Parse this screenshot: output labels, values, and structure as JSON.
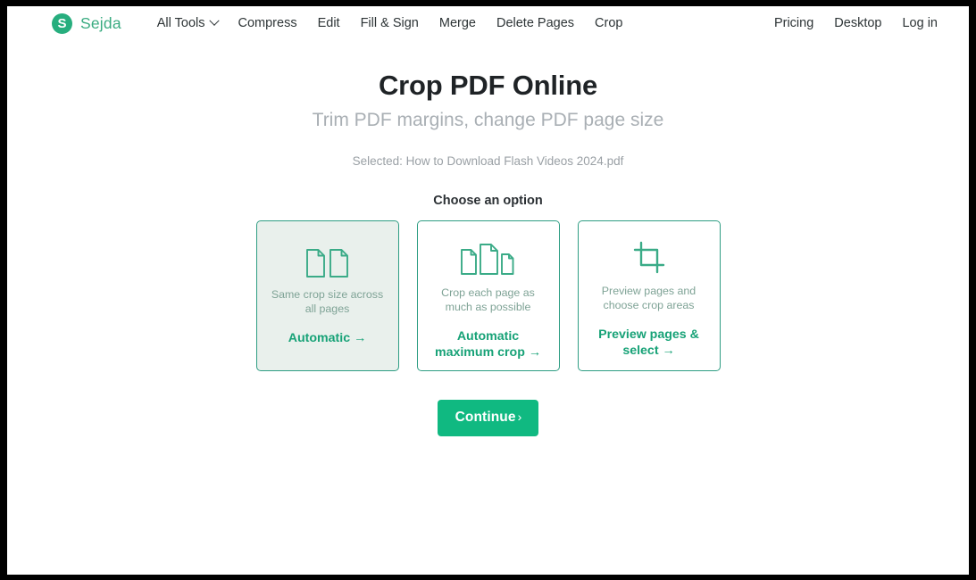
{
  "brand": {
    "mark": "S",
    "name": "Sejda"
  },
  "nav": {
    "left": [
      {
        "label": "All Tools",
        "has_chevron": true
      },
      {
        "label": "Compress",
        "has_chevron": false
      },
      {
        "label": "Edit",
        "has_chevron": false
      },
      {
        "label": "Fill & Sign",
        "has_chevron": false
      },
      {
        "label": "Merge",
        "has_chevron": false
      },
      {
        "label": "Delete Pages",
        "has_chevron": false
      },
      {
        "label": "Crop",
        "has_chevron": false
      }
    ],
    "right": [
      {
        "label": "Pricing"
      },
      {
        "label": "Desktop"
      },
      {
        "label": "Log in"
      }
    ]
  },
  "hero": {
    "title": "Crop PDF Online",
    "subtitle": "Trim PDF margins, change PDF page size",
    "selected_file": "Selected: How to Download Flash Videos 2024.pdf"
  },
  "options": {
    "heading": "Choose an option",
    "cards": [
      {
        "icon": "two-equal-documents-icon",
        "description": "Same crop size across all pages",
        "action": "Automatic",
        "arrow": "→",
        "selected": true
      },
      {
        "icon": "three-varied-documents-icon",
        "description": "Crop each page as much as possible",
        "action": "Automatic maximum crop",
        "arrow": "→",
        "selected": false
      },
      {
        "icon": "crop-tool-icon",
        "description": "Preview pages and choose crop areas",
        "action": "Preview pages & select",
        "arrow": "→",
        "selected": false
      }
    ]
  },
  "continue": {
    "label": "Continue",
    "caret": "›"
  },
  "colors": {
    "brand_green": "#27ae7e",
    "accent_green": "#17a277",
    "card_border": "#2e9d83",
    "card_selected_bg": "#e9f0ec",
    "button_green": "#10b981",
    "muted_text": "#a9afb4"
  }
}
